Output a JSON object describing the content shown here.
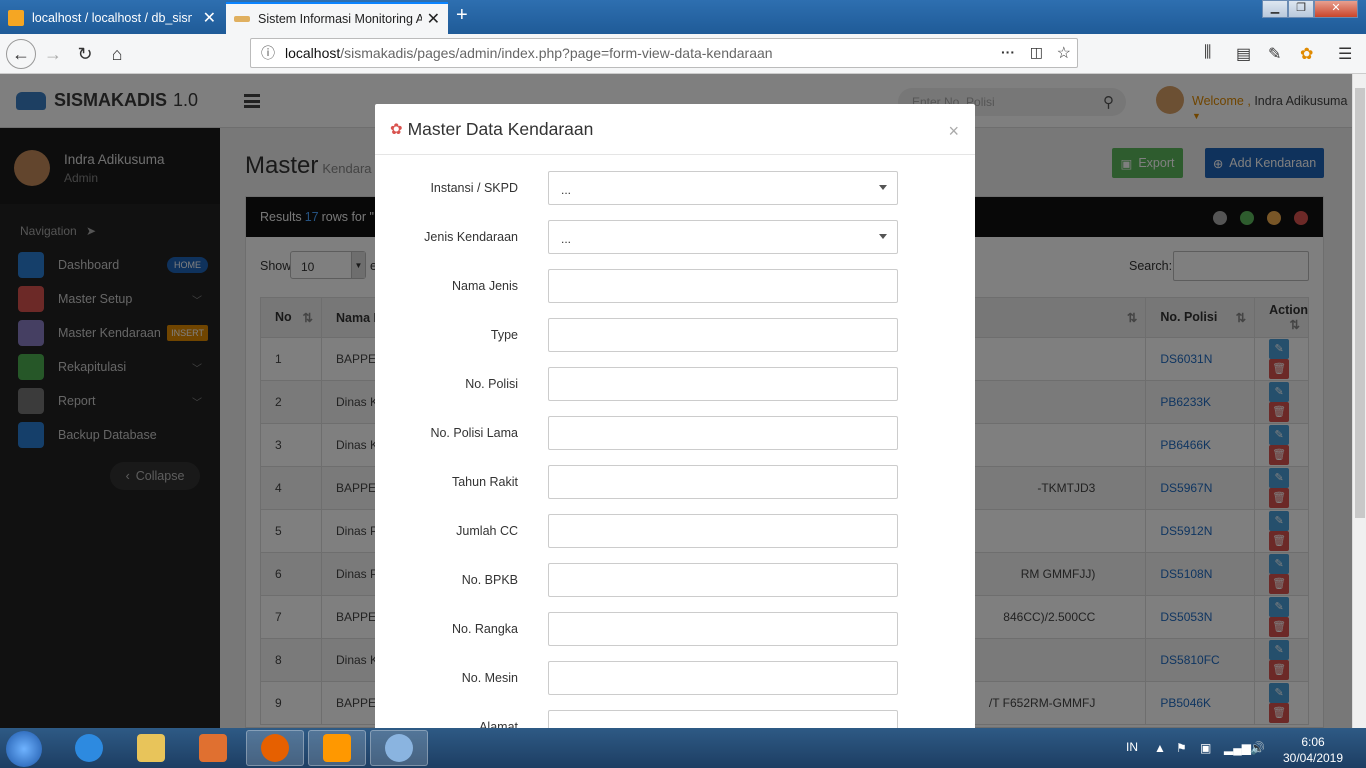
{
  "browser": {
    "tabs": [
      {
        "label": "localhost / localhost / db_sisma"
      },
      {
        "label": "Sistem Informasi Monitoring A"
      }
    ],
    "url_host": "localhost",
    "url_path": "/sismakadis/pages/admin/index.php?page=form-view-data-kendaraan"
  },
  "app": {
    "logo_name": "SISMAKADIS",
    "logo_version": "1.0",
    "search_placeholder": "Enter No. Polisi",
    "welcome_label": "Welcome ,",
    "welcome_name": "Indra Adikusuma"
  },
  "sidebar": {
    "user_name": "Indra Adikusuma",
    "user_role": "Admin",
    "nav_header": "Navigation",
    "items": [
      {
        "label": "Dashboard",
        "badge": "HOME",
        "color": "#2a7fd4",
        "badge_color": "#1f64b8"
      },
      {
        "label": "Master Setup",
        "color": "#d9534f"
      },
      {
        "label": "Master Kendaraan",
        "badge": "INSERT",
        "color": "#8a7fc4",
        "badge_color": "#e08a00"
      },
      {
        "label": "Rekapitulasi",
        "color": "#4caf50"
      },
      {
        "label": "Report",
        "color": "#777777"
      },
      {
        "label": "Backup Database",
        "color": "#2a7fd4"
      }
    ],
    "collapse_label": "Collapse"
  },
  "content": {
    "title": "Master",
    "subtitle": "Kendara",
    "export_label": "Export",
    "add_label": "Add Kendaraan",
    "results_prefix": "Results",
    "results_count": "17",
    "results_suffix": "rows for \"D",
    "show_label": "Show",
    "show_value": "10",
    "show_suffix": "e",
    "search_label": "Search:",
    "columns": [
      "No",
      "Nama I",
      "",
      "No. Polisi",
      "Action"
    ],
    "rows": [
      {
        "no": "1",
        "nama": "BAPPEI",
        "ket": "",
        "polisi": "DS6031N"
      },
      {
        "no": "2",
        "nama": "Dinas K",
        "ket": "",
        "polisi": "PB6233K"
      },
      {
        "no": "3",
        "nama": "Dinas K",
        "ket": "",
        "polisi": "PB6466K"
      },
      {
        "no": "4",
        "nama": "BAPPEI",
        "ket": "-TKMTJD3",
        "polisi": "DS5967N"
      },
      {
        "no": "5",
        "nama": "Dinas P",
        "ket": "",
        "polisi": "DS5912N"
      },
      {
        "no": "6",
        "nama": "Dinas P",
        "ket": "RM GMMFJJ)",
        "polisi": "DS5108N"
      },
      {
        "no": "7",
        "nama": "BAPPEI",
        "ket": "846CC)/2.500CC",
        "polisi": "DS5053N"
      },
      {
        "no": "8",
        "nama": "Dinas K",
        "ket": "",
        "polisi": "DS5810FC"
      },
      {
        "no": "9",
        "nama": "BAPPEI",
        "ket": "/T F652RM-GMMFJ",
        "polisi": "PB5046K"
      }
    ]
  },
  "modal": {
    "title": "Master Data Kendaraan",
    "close": "×",
    "fields": [
      {
        "label": "Instansi / SKPD",
        "value": "...",
        "type": "select"
      },
      {
        "label": "Jenis Kendaraan",
        "value": "...",
        "type": "select"
      },
      {
        "label": "Nama Jenis",
        "value": ""
      },
      {
        "label": "Type",
        "value": ""
      },
      {
        "label": "No. Polisi",
        "value": ""
      },
      {
        "label": "No. Polisi Lama",
        "value": ""
      },
      {
        "label": "Tahun Rakit",
        "value": ""
      },
      {
        "label": "Jumlah CC",
        "value": ""
      },
      {
        "label": "No. BPKB",
        "value": ""
      },
      {
        "label": "No. Rangka",
        "value": ""
      },
      {
        "label": "No. Mesin",
        "value": ""
      },
      {
        "label": "Alamat",
        "value": ""
      }
    ]
  },
  "taskbar": {
    "lang": "IN",
    "time": "6:06",
    "date": "30/04/2019"
  }
}
